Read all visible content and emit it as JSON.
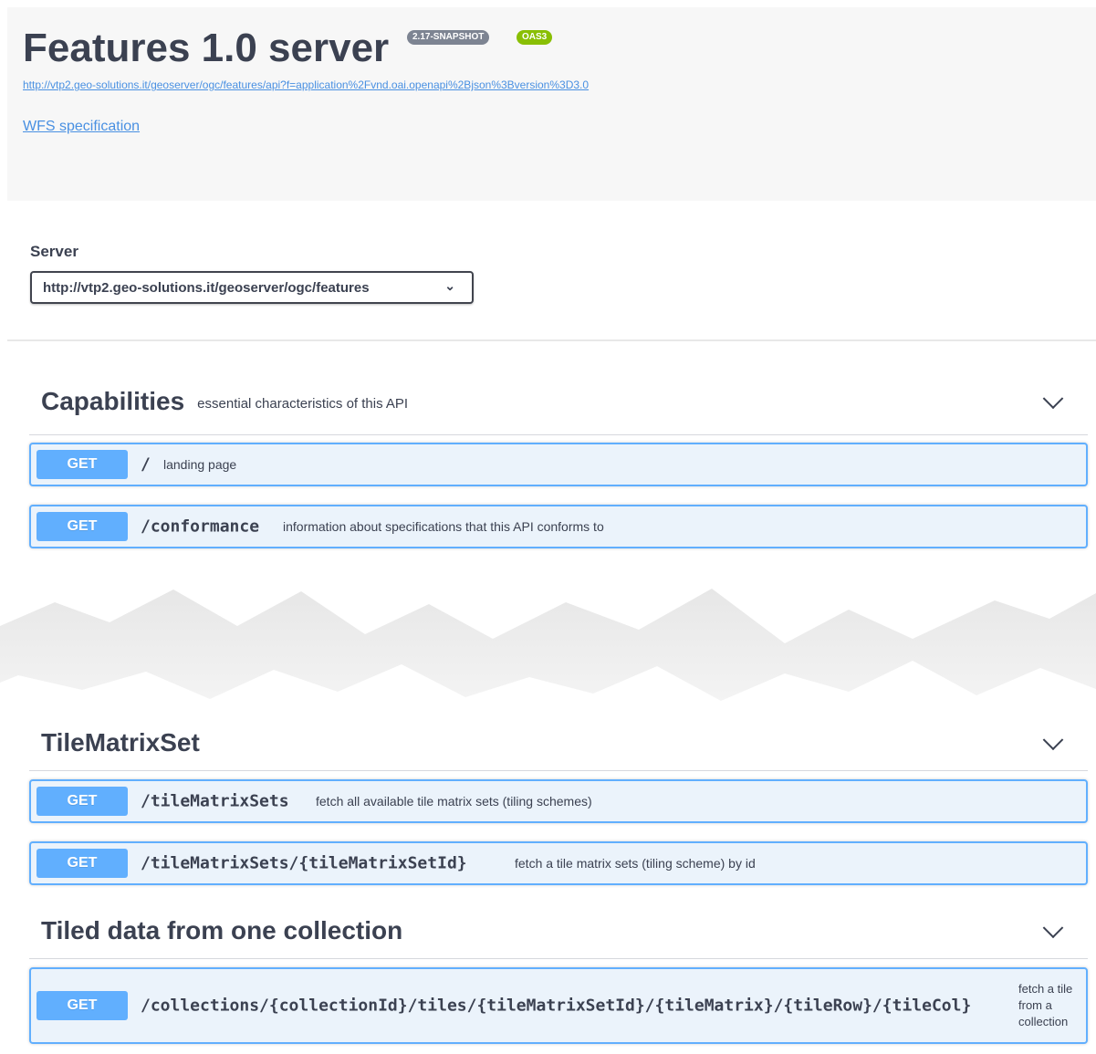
{
  "info": {
    "title": "Features 1.0 server",
    "version_badge": "2.17-SNAPSHOT",
    "oas_badge": "OAS3",
    "spec_url": "http://vtp2.geo-solutions.it/geoserver/ogc/features/api?f=application%2Fvnd.oai.openapi%2Bjson%3Bversion%3D3.0",
    "external_docs_link": "WFS specification"
  },
  "servers": {
    "label": "Server",
    "selected": "http://vtp2.geo-solutions.it/geoserver/ogc/features"
  },
  "tags": [
    {
      "name": "Capabilities",
      "description": "essential characteristics of this API",
      "operations": [
        {
          "method": "GET",
          "path": "/",
          "summary": "landing page"
        },
        {
          "method": "GET",
          "path": "/conformance",
          "summary": "information about specifications that this API conforms to"
        }
      ]
    },
    {
      "name": "TileMatrixSet",
      "description": "",
      "operations": [
        {
          "method": "GET",
          "path": "/tileMatrixSets",
          "summary": "fetch all available tile matrix sets (tiling schemes)"
        },
        {
          "method": "GET",
          "path": "/tileMatrixSets/{tileMatrixSetId}",
          "summary": "fetch a tile matrix sets (tiling scheme) by id"
        }
      ]
    },
    {
      "name": "Tiled data from one collection",
      "description": "",
      "operations": [
        {
          "method": "GET",
          "path": "/collections/{collectionId}/tiles/{tileMatrixSetId}/{tileMatrix}/{tileRow}/{tileCol}",
          "summary": "fetch a tile from a collection"
        }
      ]
    }
  ],
  "colors": {
    "get_method": "#61affe",
    "get_background": "#ebf3fb",
    "link": "#4990e2",
    "oas_badge": "#89bf04",
    "version_badge": "#7d8492"
  }
}
